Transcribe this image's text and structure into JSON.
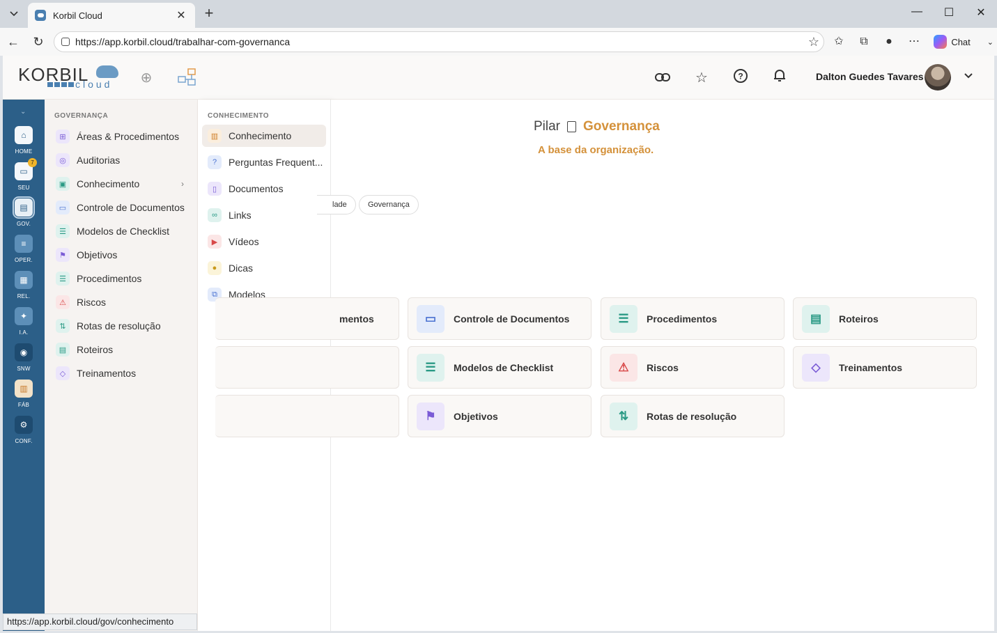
{
  "browser": {
    "tab_title": "Korbil Cloud",
    "url": "https://app.korbil.cloud/trabalhar-com-governanca",
    "chat_label": "Chat",
    "status_url": "https://app.korbil.cloud/gov/conhecimento"
  },
  "header": {
    "logo_word": "KORBIL",
    "logo_sub": "cloud",
    "user_name": "Dalton Guedes Tavares"
  },
  "rail": {
    "items": [
      {
        "label": "HOME",
        "icon": "home-icon"
      },
      {
        "label": "SEU",
        "icon": "briefcase-icon",
        "badge": "7"
      },
      {
        "label": "GOV.",
        "icon": "clipboard-icon"
      },
      {
        "label": "OPER.",
        "icon": "list-icon"
      },
      {
        "label": "REL.",
        "icon": "bar-chart-icon"
      },
      {
        "label": "I.A.",
        "icon": "sparkles-icon"
      },
      {
        "label": "SNW",
        "icon": "globe-icon"
      },
      {
        "label": "FÁB",
        "icon": "factory-icon"
      },
      {
        "label": "CONF.",
        "icon": "gear-icon"
      }
    ]
  },
  "menu1": {
    "heading": "GOVERNANÇA",
    "items": [
      {
        "label": "Áreas & Procedimentos",
        "icon": "org-chart-icon"
      },
      {
        "label": "Auditorias",
        "icon": "audit-icon"
      },
      {
        "label": "Conhecimento",
        "icon": "book-icon"
      },
      {
        "label": "Controle de Documentos",
        "icon": "folder-gear-icon"
      },
      {
        "label": "Modelos de Checklist",
        "icon": "checklist-icon"
      },
      {
        "label": "Objetivos",
        "icon": "flag-icon"
      },
      {
        "label": "Procedimentos",
        "icon": "checklist-icon"
      },
      {
        "label": "Riscos",
        "icon": "warning-icon"
      },
      {
        "label": "Rotas de resolução",
        "icon": "route-icon"
      },
      {
        "label": "Roteiros",
        "icon": "calendar-icon"
      },
      {
        "label": "Treinamentos",
        "icon": "graduation-cap-icon"
      }
    ]
  },
  "menu2": {
    "heading": "CONHECIMENTO",
    "items": [
      {
        "label": "Conhecimento",
        "icon": "book-open-icon"
      },
      {
        "label": "Perguntas Frequent...",
        "icon": "faq-icon"
      },
      {
        "label": "Documentos",
        "icon": "document-icon"
      },
      {
        "label": "Links",
        "icon": "link-icon"
      },
      {
        "label": "Vídeos",
        "icon": "video-icon"
      },
      {
        "label": "Dicas",
        "icon": "lightbulb-icon"
      },
      {
        "label": "Modelos",
        "icon": "copy-icon"
      }
    ]
  },
  "main": {
    "pilar_label": "Pilar",
    "pilar_name": "Governança",
    "subtitle": "A base da organização.",
    "chips": [
      "lade",
      "Governança"
    ],
    "cards": [
      {
        "label": "mentos",
        "icon": ""
      },
      {
        "label": "Controle de Documentos",
        "icon": "folder-gear-icon"
      },
      {
        "label": "Procedimentos",
        "icon": "checklist-icon"
      },
      {
        "label": "Roteiros",
        "icon": "calendar-icon"
      },
      {
        "label": "Modelos de Checklist",
        "icon": "checklist-icon"
      },
      {
        "label": "Riscos",
        "icon": "warning-icon"
      },
      {
        "label": "Treinamentos",
        "icon": "graduation-cap-icon"
      },
      {
        "label": "Objetivos",
        "icon": "flag-icon"
      },
      {
        "label": "Rotas de resolução",
        "icon": "route-icon"
      }
    ]
  }
}
